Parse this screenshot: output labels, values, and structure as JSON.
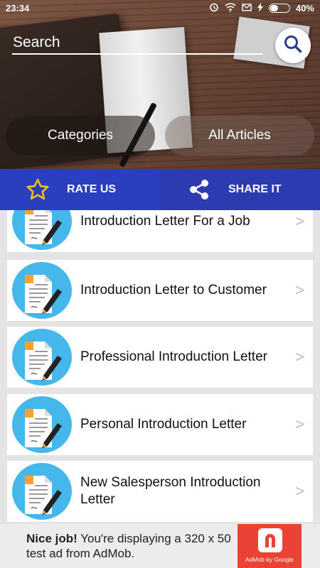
{
  "status": {
    "time": "23:34",
    "battery": "40%",
    "battery_level": 0.4
  },
  "header": {
    "search_placeholder": "Search",
    "tabs": [
      {
        "label": "Categories"
      },
      {
        "label": "All Articles"
      }
    ]
  },
  "actions": {
    "rate": "RATE US",
    "share": "SHARE IT"
  },
  "list": {
    "items": [
      {
        "title": "Introduction Letter For a Job"
      },
      {
        "title": "Introduction Letter to Customer"
      },
      {
        "title": "Professional Introduction Letter"
      },
      {
        "title": "Personal Introduction Letter"
      },
      {
        "title": "New Salesperson Introduction Letter"
      }
    ],
    "chevron": ">"
  },
  "ad": {
    "bold": "Nice job!",
    "text": " You're displaying a 320 x 50 test ad from AdMob.",
    "brand": "AdMob by Google"
  },
  "colors": {
    "action_bar": "#2a3fbf",
    "icon_circle": "#45b7ea",
    "accent_orange": "#f5a233"
  }
}
